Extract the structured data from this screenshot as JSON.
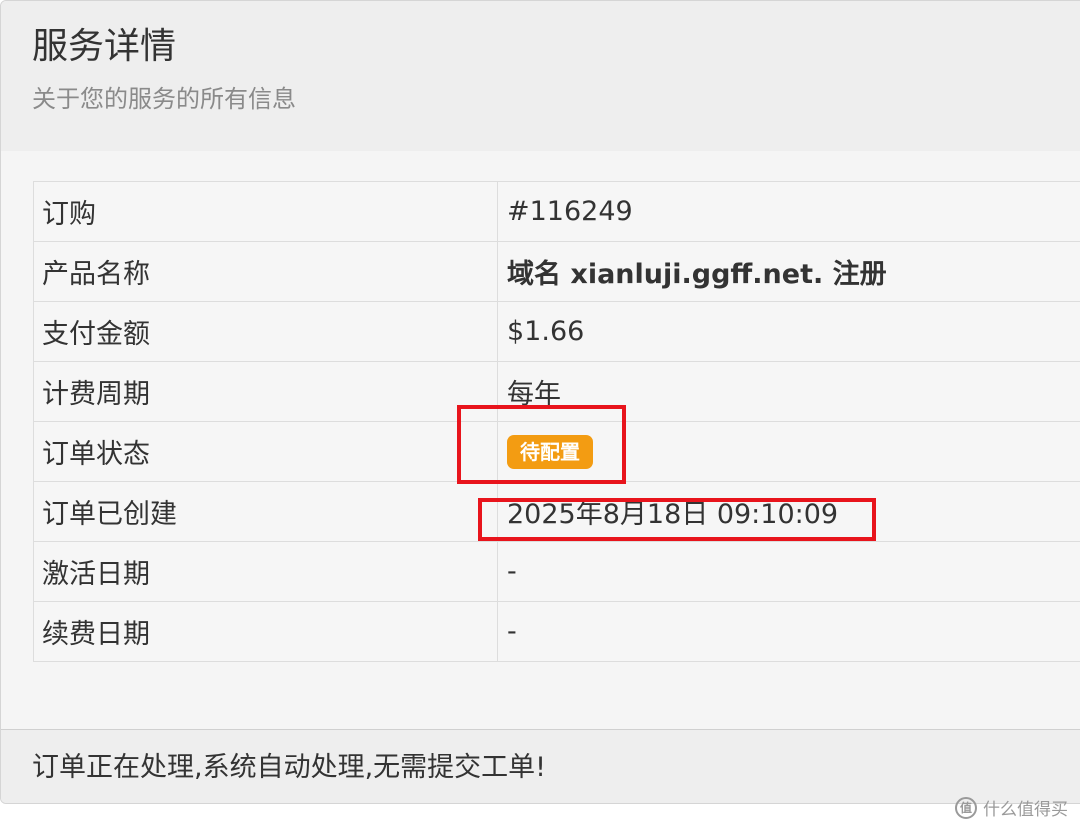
{
  "header": {
    "title": "服务详情",
    "subtitle": "关于您的服务的所有信息"
  },
  "details": {
    "rows": [
      {
        "label": "订购",
        "value": "#116249"
      },
      {
        "label": "产品名称",
        "value": "域名 xianluji.ggff.net. 注册"
      },
      {
        "label": "支付金额",
        "value": "$1.66"
      },
      {
        "label": "计费周期",
        "value": "每年"
      },
      {
        "label": "订单状态",
        "value": "待配置"
      },
      {
        "label": "订单已创建",
        "value": "2025年8月18日 09:10:09"
      },
      {
        "label": "激活日期",
        "value": "-"
      },
      {
        "label": "续费日期",
        "value": "-"
      }
    ]
  },
  "status": {
    "badge_color": "#f39c12"
  },
  "footer": {
    "message": "订单正在处理,系统自动处理,无需提交工单!"
  },
  "watermark": {
    "logo_text": "值",
    "text": "什么值得买"
  },
  "colors": {
    "highlight": "#e8141c",
    "header_bg": "#eeeeee",
    "panel_bg": "#f5f5f5"
  }
}
